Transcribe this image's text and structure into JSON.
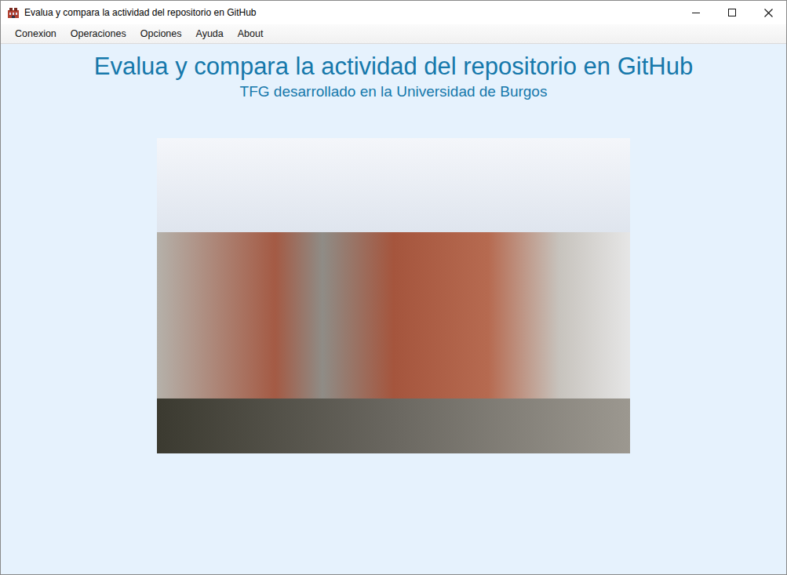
{
  "window": {
    "title": "Evalua y compara la actividad del repositorio en GitHub"
  },
  "menu": [
    {
      "label": "Conexion"
    },
    {
      "label": "Operaciones"
    },
    {
      "label": "Opciones"
    },
    {
      "label": "Ayuda"
    },
    {
      "label": "About"
    }
  ],
  "content": {
    "heading": "Evalua y compara la actividad del repositorio en GitHub",
    "subheading": "TFG desarrollado en la Universidad de Burgos"
  }
}
